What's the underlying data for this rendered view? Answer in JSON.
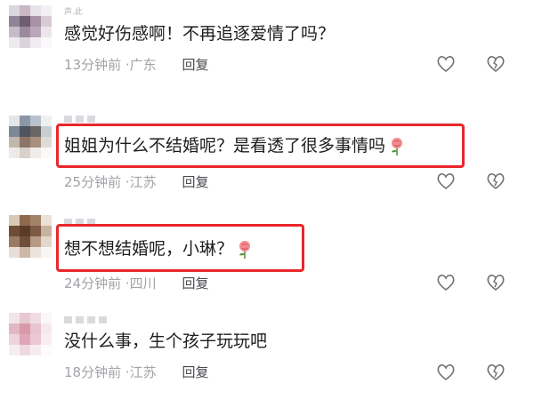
{
  "comments": [
    {
      "username": "声.此",
      "text": "感觉好伤感啊！不再追逐爱情了吗？",
      "time": "13分钟前",
      "location": "广东",
      "reply": "回复"
    },
    {
      "username": "",
      "text": "姐姐为什么不结婚呢？是看透了很多事情吗",
      "time": "25分钟前",
      "location": "江苏",
      "reply": "回复"
    },
    {
      "username": "",
      "text": "想不想结婚呢，小琳？",
      "time": "24分钟前",
      "location": "四川",
      "reply": "回复"
    },
    {
      "username": "",
      "text": "没什么事，生个孩子玩玩吧",
      "time": "18分钟前",
      "location": "江苏",
      "reply": "回复"
    }
  ],
  "separator": "·",
  "icons": {
    "like": "heart-outline-icon",
    "dislike": "broken-heart-outline-icon",
    "emoji": "rose-emoji"
  },
  "colors": {
    "highlight": "#e8262b",
    "meta": "#a2a2a8",
    "text": "#1d1d1f"
  }
}
